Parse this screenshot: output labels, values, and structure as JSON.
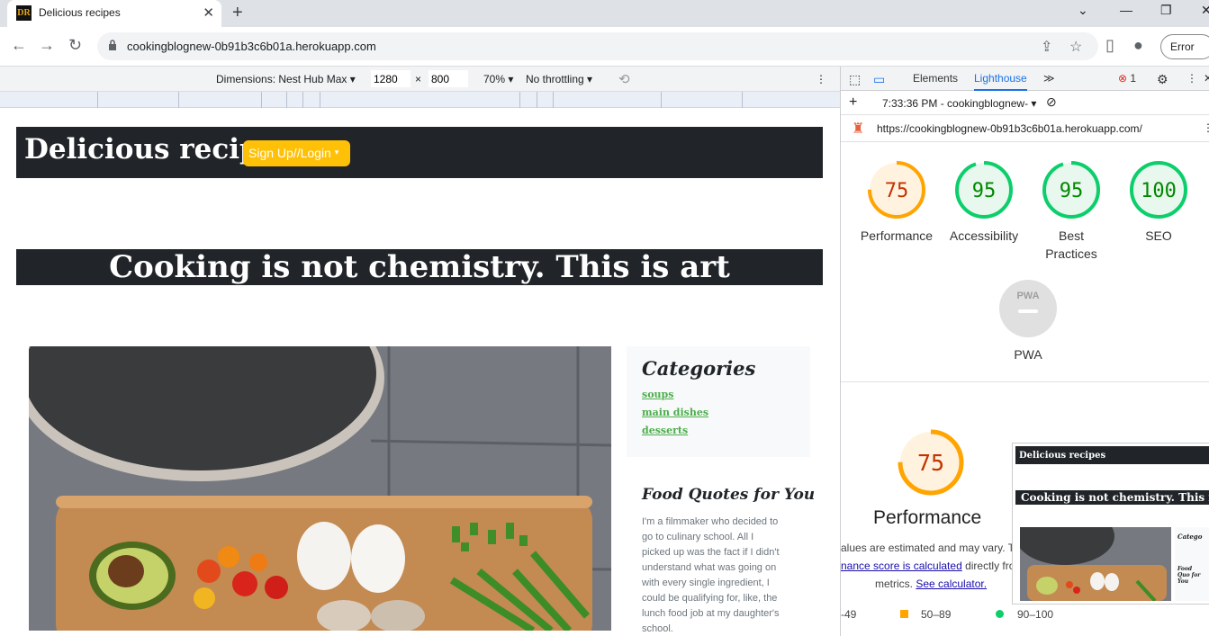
{
  "browser": {
    "tab_title": "Delicious recipes",
    "favicon_text": "DR",
    "url": "cookingblognew-0b91b3c6b01a.herokuapp.com",
    "error_button": "Error"
  },
  "device_toolbar": {
    "dimensions_label": "Dimensions: Nest Hub Max",
    "width": "1280",
    "height": "800",
    "times": "×",
    "zoom": "70%",
    "throttling": "No throttling"
  },
  "page": {
    "brand": "Delicious recipes",
    "signup_button": "Sign Up//Login",
    "banner": "Cooking is not chemistry. This is art",
    "categories_title": "Categories",
    "categories": [
      "soups",
      "main dishes",
      "desserts"
    ],
    "quotes_title": "Food Quotes for You",
    "quote_lines": [
      "I'm a filmmaker who decided to",
      "go to culinary school. All I",
      "picked up was the fact if I didn't",
      "understand what was going on",
      "with every single ingredient, I",
      "could be qualifying for, like, the",
      "lunch food job at my daughter's",
      "school."
    ]
  },
  "devtools": {
    "tabs": [
      "Elements",
      "Lighthouse"
    ],
    "error_count": "1",
    "report_time": "7:33:36 PM - cookingblognew-",
    "report_url": "https://cookingblognew-0b91b3c6b01a.herokuapp.com/",
    "scores": [
      {
        "label": "Performance",
        "value": "75",
        "color": "#ffa400"
      },
      {
        "label": "Accessibility",
        "value": "95",
        "color": "#0cce6b"
      },
      {
        "label": "Best Practices",
        "value": "95",
        "color": "#0cce6b"
      },
      {
        "label": "SEO",
        "value": "100",
        "color": "#0cce6b"
      }
    ],
    "pwa_label": "PWA",
    "pwa_badge": "PWA",
    "perf_score": "75",
    "perf_title": "Performance",
    "perf_note_1": "alues are estimated and may vary. Th",
    "perf_note_2a": "nance score is calculated",
    "perf_note_2b": " directly fro",
    "perf_note_3a": "metrics. ",
    "perf_note_3b": "See calculator.",
    "legend": [
      "-49",
      "50–89",
      "90–100"
    ],
    "thumb_brand": "Delicious recipes",
    "thumb_banner": "Cooking is not chemistry. This is",
    "thumb_cat": "Catego",
    "thumb_food": "Food Quo for You"
  }
}
